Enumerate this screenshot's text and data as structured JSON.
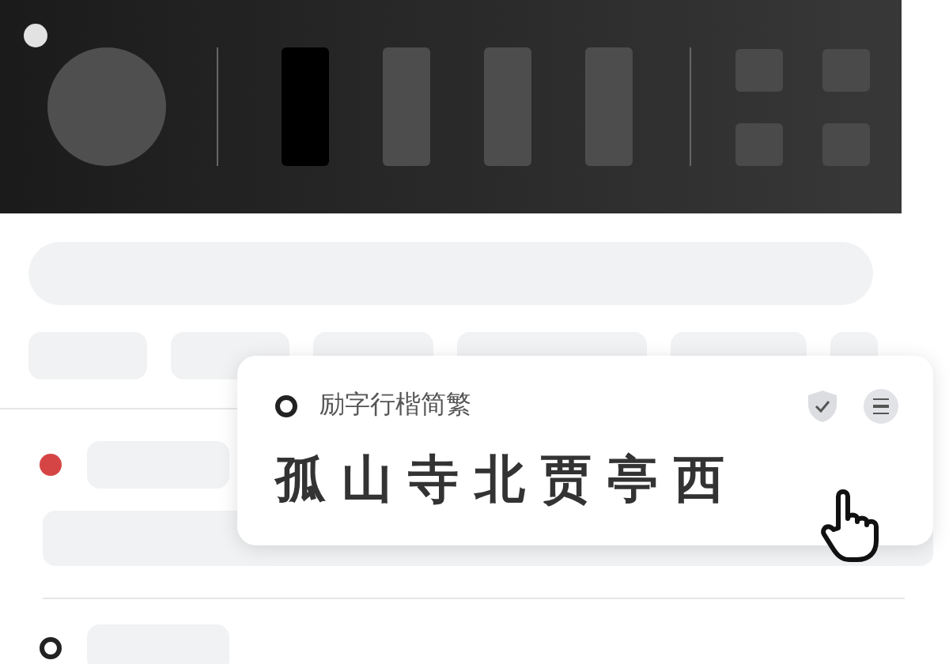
{
  "toolbar": {
    "tiles": [
      {
        "selected": true
      },
      {
        "selected": false
      },
      {
        "selected": false
      },
      {
        "selected": false
      }
    ]
  },
  "font_card": {
    "selected": false,
    "name": "励字行楷简繁",
    "sample": "孤山寺北贾亭西"
  },
  "list": [
    {
      "selected": true
    },
    {
      "selected": false
    }
  ]
}
